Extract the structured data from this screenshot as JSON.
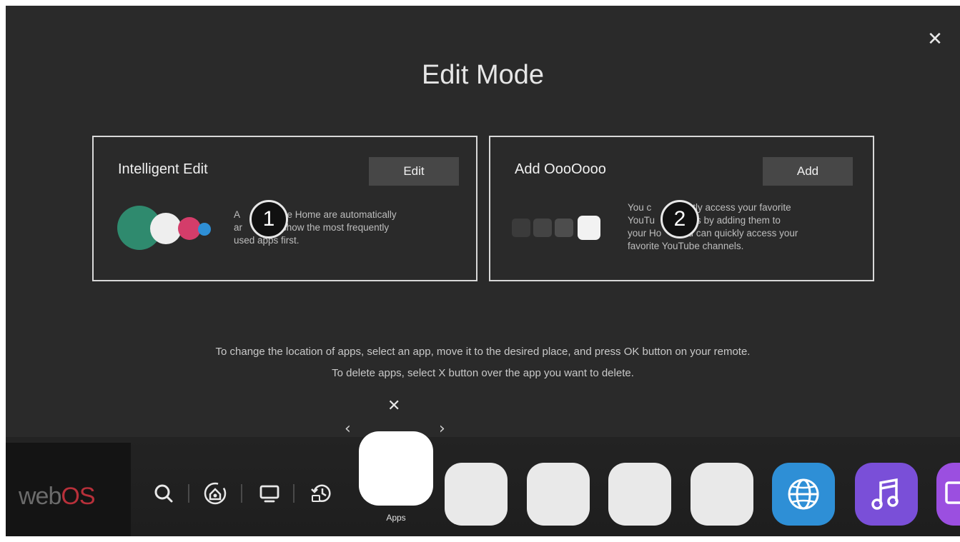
{
  "screen": {
    "title": "Edit Mode",
    "close_label": "✕"
  },
  "cards": [
    {
      "title": "Intelligent Edit",
      "button_label": "Edit",
      "badge": "1",
      "description_lines": [
        "A",
        "he Home are automatically",
        "ar",
        "to show the most frequently",
        "used apps first."
      ]
    },
    {
      "title": "Add OooOooo",
      "button_label": "Add",
      "badge": "2",
      "description_lines": [
        "You c",
        "tly access your favorite",
        "YouTu",
        "nels by adding them to",
        "your Ho",
        "You can quickly access your",
        "favorite YouTube channels."
      ]
    }
  ],
  "hints": {
    "line1": "To change the location of apps, select an app, move it to the desired place, and press OK button on your remote.",
    "line2": "To delete apps, select X button over the app you want to delete."
  },
  "launcher": {
    "logo_web": "web",
    "logo_os": "OS",
    "icons": [
      "search-icon",
      "home-dashboard-icon",
      "tv-input-icon",
      "recent-history-icon"
    ],
    "selected_app_label": "Apps",
    "delete_label": "✕",
    "left_arrow": "‹",
    "right_arrow": "›",
    "accent_colors": {
      "browser": "#2e8fd6",
      "music": "#7a4fd8",
      "partial": "#9b4fe0",
      "logo_os": "#b8303a"
    }
  }
}
